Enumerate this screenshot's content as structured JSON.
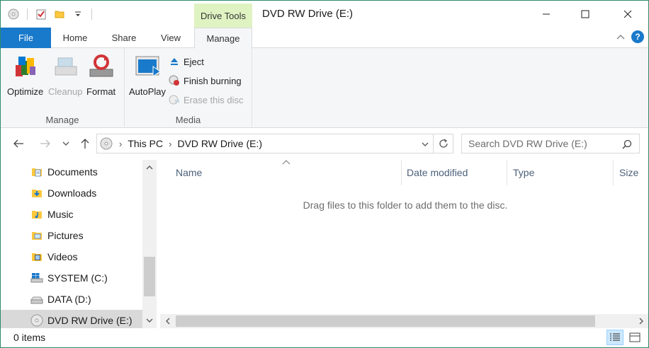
{
  "window": {
    "title": "DVD RW Drive (E:)",
    "contextual_tab": "Drive Tools",
    "caption": {
      "minimize": "—",
      "maximize": "☐",
      "close": "✕"
    }
  },
  "ribbon_tabs": {
    "file": "File",
    "home": "Home",
    "share": "Share",
    "view": "View",
    "manage": "Manage"
  },
  "ribbon": {
    "manage_group": {
      "label": "Manage",
      "optimize": "Optimize",
      "cleanup": "Cleanup",
      "format": "Format"
    },
    "media_group": {
      "label": "Media",
      "autoplay": "AutoPlay",
      "eject": "Eject",
      "finish_burning": "Finish burning",
      "erase_disc": "Erase this disc"
    }
  },
  "navigation": {
    "breadcrumbs": [
      "This PC",
      "DVD RW Drive (E:)"
    ],
    "search_placeholder": "Search DVD RW Drive (E:)"
  },
  "nav_pane": {
    "items": [
      {
        "label": "Documents",
        "icon": "documents-folder-icon"
      },
      {
        "label": "Downloads",
        "icon": "downloads-folder-icon"
      },
      {
        "label": "Music",
        "icon": "music-folder-icon"
      },
      {
        "label": "Pictures",
        "icon": "pictures-folder-icon"
      },
      {
        "label": "Videos",
        "icon": "videos-folder-icon"
      },
      {
        "label": "SYSTEM (C:)",
        "icon": "windows-drive-icon"
      },
      {
        "label": "DATA (D:)",
        "icon": "hard-drive-icon"
      },
      {
        "label": "DVD RW Drive (E:)",
        "icon": "dvd-drive-icon",
        "selected": true
      }
    ]
  },
  "content": {
    "columns": {
      "name": "Name",
      "date_modified": "Date modified",
      "type": "Type",
      "size": "Size"
    },
    "empty_message": "Drag files to this folder to add them to the disc."
  },
  "status": {
    "item_count": "0 items"
  },
  "colors": {
    "accent": "#1979ca",
    "contextual_tab": "#dff3c2",
    "window_border": "#2b8a6e"
  }
}
